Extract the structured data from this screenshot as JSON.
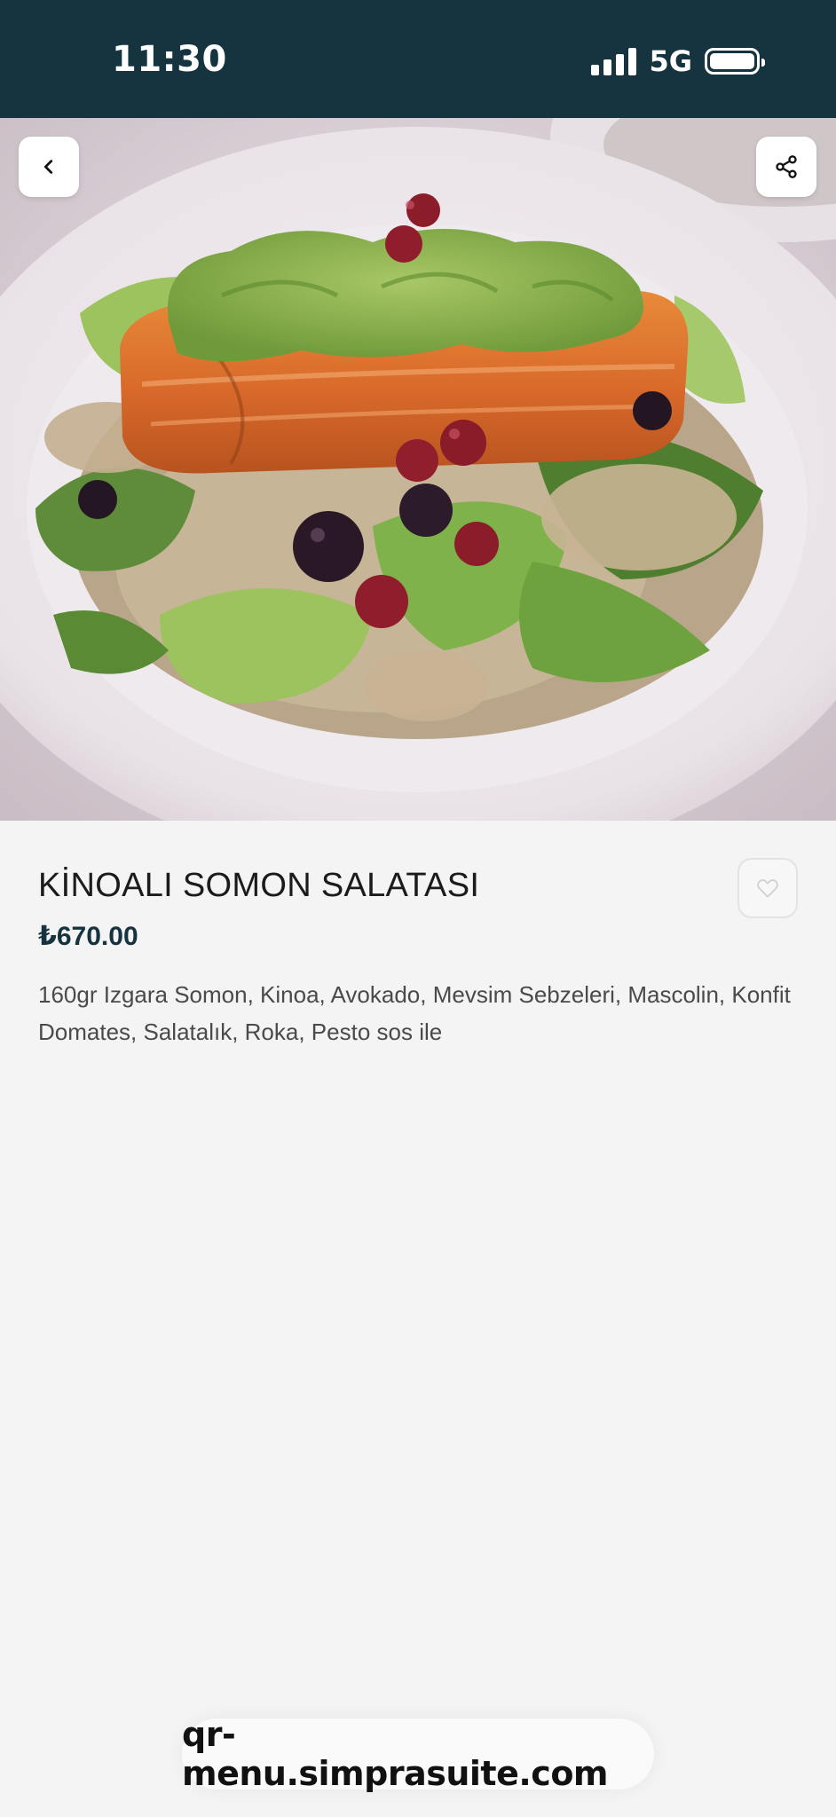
{
  "status_bar": {
    "time": "11:30",
    "network": "5G",
    "signal_bars": 4,
    "battery_level": 1.0
  },
  "hero": {
    "image": "grilled salmon quinoa salad plate",
    "back_icon": "chevron-left-icon",
    "share_icon": "share-icon"
  },
  "item": {
    "title": "KİNOALI SOMON SALATASI",
    "price": "₺670.00",
    "description": "160gr Izgara Somon, Kinoa, Avokado, Mevsim Sebzeleri, Mascolin, Konfit Domates, Salatalık, Roka, Pesto sos ile",
    "favorite_icon": "heart-icon"
  },
  "browser": {
    "url": "qr-menu.simprasuite.com"
  },
  "colors": {
    "status_bar_bg": "#163440",
    "price": "#163440",
    "page_bg": "#f4f4f4"
  }
}
